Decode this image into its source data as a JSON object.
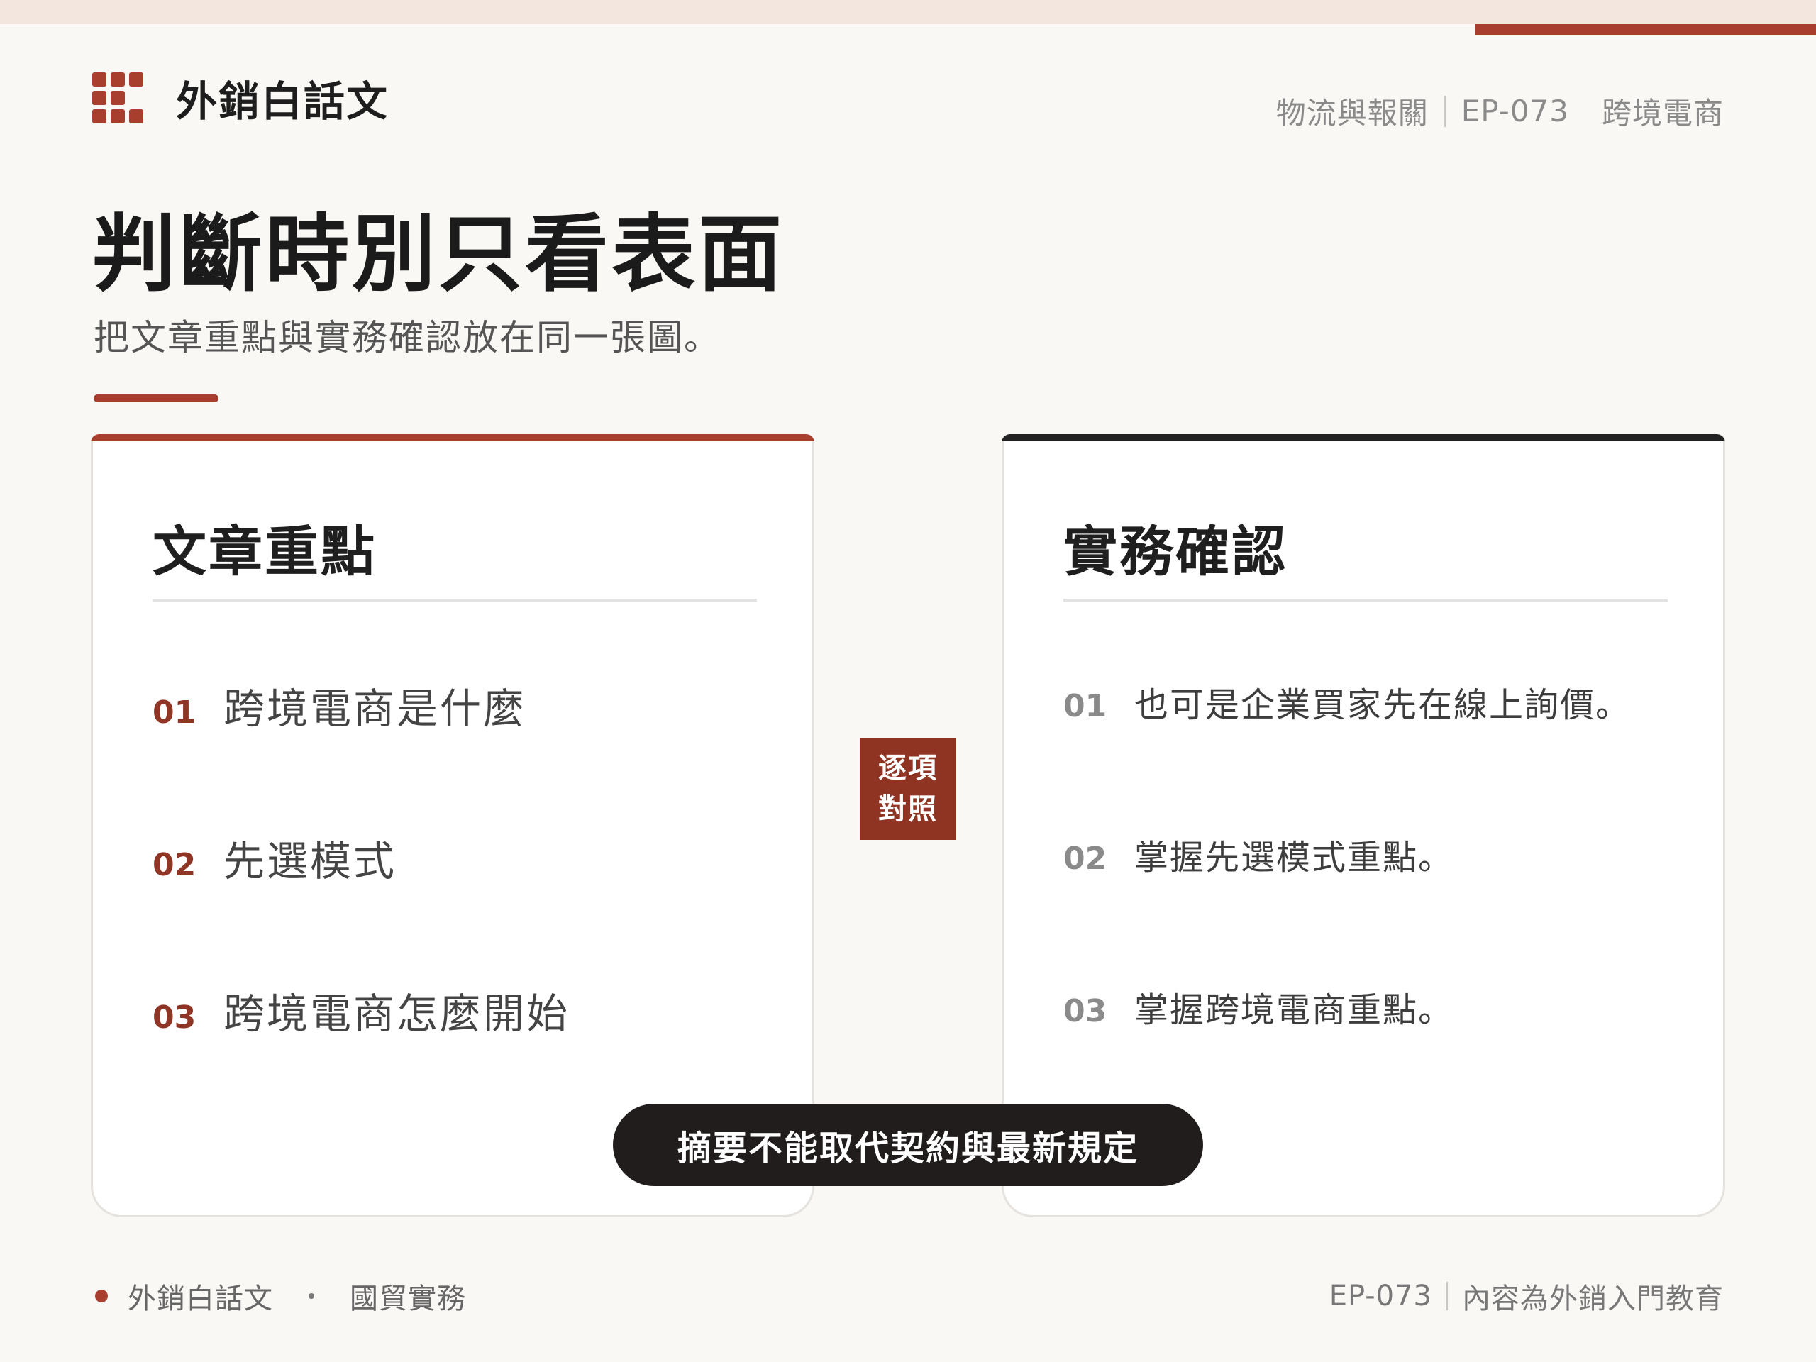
{
  "brand": {
    "name": "外銷白話文",
    "logo_icon": "brick-grid-icon",
    "accent": "#a83f2e"
  },
  "header": {
    "category": "物流與報關",
    "episode": "EP-073",
    "topic": "跨境電商"
  },
  "title": "判斷時別只看表面",
  "subtitle": "把文章重點與實務確認放在同一張圖。",
  "left_card": {
    "heading": "文章重點",
    "items": [
      {
        "num": "01",
        "text": "跨境電商是什麼"
      },
      {
        "num": "02",
        "text": "先選模式"
      },
      {
        "num": "03",
        "text": "跨境電商怎麼開始"
      }
    ]
  },
  "right_card": {
    "heading": "實務確認",
    "items": [
      {
        "num": "01",
        "text": "也可是企業買家先在線上詢價。"
      },
      {
        "num": "02",
        "text": "掌握先選模式重點。"
      },
      {
        "num": "03",
        "text": "掌握跨境電商重點。"
      }
    ]
  },
  "compare_tag": {
    "line1": "逐項",
    "line2": "對照"
  },
  "notice": "摘要不能取代契約與最新規定",
  "footer": {
    "brand": "外銷白話文",
    "section": "國貿實務",
    "episode": "EP-073",
    "note": "內容為外銷入門教育"
  }
}
